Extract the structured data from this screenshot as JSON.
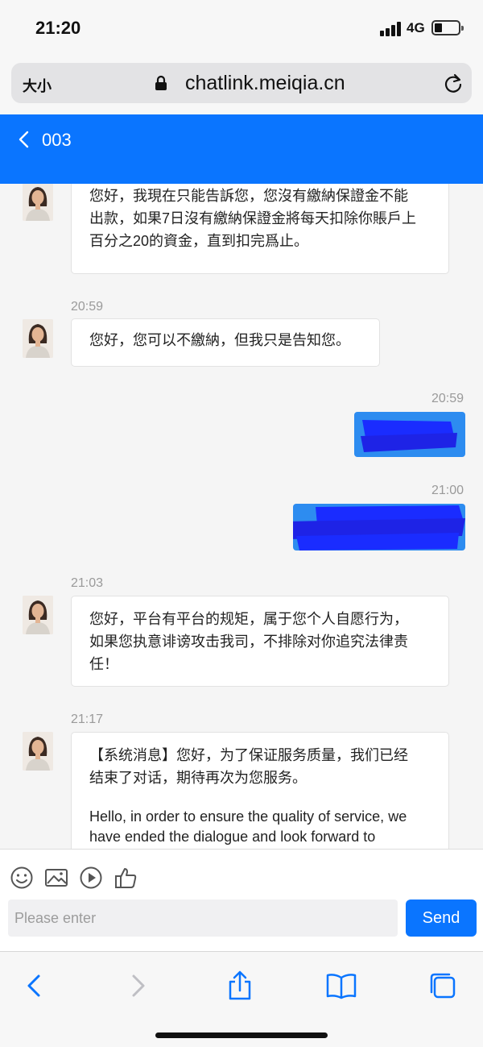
{
  "status_bar": {
    "time": "21:20",
    "network": "4G"
  },
  "browser": {
    "size_label": "大小",
    "url": "chatlink.meiqia.cn"
  },
  "header": {
    "title": "003"
  },
  "messages": [
    {
      "side": "agent",
      "time": "",
      "lines": [
        "您好，我現在只能告訴您，您沒有繳納保證金不能",
        "出款，如果7日沒有繳納保證金將每天扣除你賬戶上",
        "百分之20的資金，直到扣完爲止。"
      ]
    },
    {
      "side": "agent",
      "time": "20:59",
      "lines": [
        "您好，您可以不繳納，但我只是告知您。"
      ]
    },
    {
      "side": "user",
      "time": "20:59",
      "lines": [],
      "redacted": true
    },
    {
      "side": "user",
      "time": "21:00",
      "lines": [],
      "redacted": true
    },
    {
      "side": "agent",
      "time": "21:03",
      "lines": [
        "您好，平台有平台的规矩，属于您个人自愿行为，",
        "如果您执意诽谤攻击我司，不排除对你追究法律责",
        "任！"
      ]
    },
    {
      "side": "agent",
      "time": "21:17",
      "lines": [
        "【系统消息】您好，为了保证服务质量，我们已经",
        "结束了对话，期待再次为您服务。",
        "",
        "Hello, in order to ensure the quality of service, we",
        "have ended the dialogue and look forward to"
      ]
    }
  ],
  "input": {
    "placeholder": "Please enter",
    "send_label": "Send"
  },
  "toolbar_icons": [
    "emoji-icon",
    "image-icon",
    "play-icon",
    "thumbs-up-icon"
  ],
  "safari_toolbar": [
    "back-icon",
    "forward-icon",
    "share-icon",
    "bookmarks-icon",
    "tabs-icon"
  ],
  "colors": {
    "accent": "#0a75ff",
    "redaction": "#1a2cff",
    "user_bubble": "#2d8cf0"
  }
}
